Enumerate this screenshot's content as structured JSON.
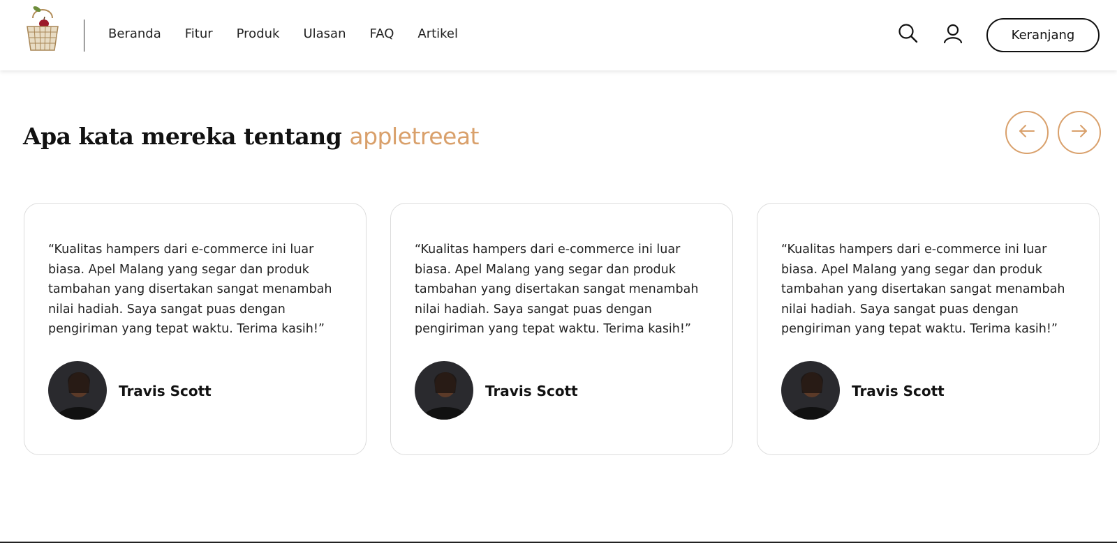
{
  "header": {
    "nav": [
      "Beranda",
      "Fitur",
      "Produk",
      "Ulasan",
      "FAQ",
      "Artikel"
    ],
    "cart_label": "Keranjang",
    "icons": {
      "search": "search-icon",
      "user": "user-icon",
      "logo": "apple-basket-logo"
    }
  },
  "section": {
    "title_main": "Apa kata mereka tentang ",
    "title_brand": "appletreeat",
    "prev_icon": "arrow-left-icon",
    "next_icon": "arrow-right-icon"
  },
  "testimonials": [
    {
      "quote": "“Kualitas hampers dari e-commerce ini luar biasa. Apel Malang yang segar dan produk tambahan yang disertakan sangat menambah nilai hadiah. Saya sangat puas dengan pengiriman yang tepat waktu. Terima kasih!”",
      "name": "Travis Scott"
    },
    {
      "quote": "“Kualitas hampers dari e-commerce ini luar biasa. Apel Malang yang segar dan produk tambahan yang disertakan sangat menambah nilai hadiah. Saya sangat puas dengan pengiriman yang tepat waktu. Terima kasih!”",
      "name": "Travis Scott"
    },
    {
      "quote": "“Kualitas hampers dari e-commerce ini luar biasa. Apel Malang yang segar dan produk tambahan yang disertakan sangat menambah nilai hadiah. Saya sangat puas dengan pengiriman yang tepat waktu. Terima kasih!”",
      "name": "Travis Scott"
    }
  ],
  "colors": {
    "accent": "#D9A06B",
    "text": "#111111",
    "card_border": "#DCDCDC"
  }
}
